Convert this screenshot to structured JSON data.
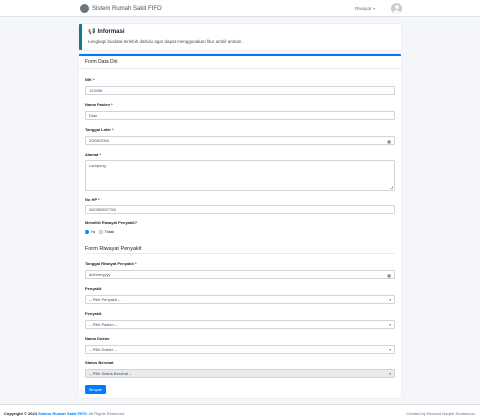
{
  "navbar": {
    "brand": "Sistem Rumah Sakit FIFO",
    "menu_label": "Riwayat",
    "menu_caret": "▾"
  },
  "info": {
    "icon": "megaphone-icon",
    "icon_glyph": "📢",
    "title": "Informasi",
    "text": "Lengkapi biodata terlebih dahulu agar dapat menggunakan fitur ambil antrian."
  },
  "form": {
    "header": "Form Data Diri",
    "nik": {
      "label": "NIK *",
      "value": "123456"
    },
    "nama": {
      "label": "Nama Pasien *",
      "value": "Dian"
    },
    "tgl_lahir": {
      "label": "Tanggal Lahir *",
      "value": "20/06/2004"
    },
    "alamat": {
      "label": "Alamat *",
      "value": "Lampung"
    },
    "hp": {
      "label": "No HP *",
      "value": "082289837758"
    },
    "riwayat_question": {
      "label": "Memiliki Riwayat Penyakit?",
      "options": [
        "Ya",
        "Tidak"
      ],
      "selected": "Ya"
    },
    "riwayat_section_title": "Form Riwayat Penyakit",
    "tgl_riwayat": {
      "label": "Tanggal Riwayat Penyakit *",
      "placeholder": "dd/mm/yyyy"
    },
    "penyakit1": {
      "label": "Penyakit",
      "value": "-- Pilih Penyakit --"
    },
    "penyakit2": {
      "label": "Penyakit",
      "value": "-- Pilih Pasien --"
    },
    "dokter": {
      "label": "Nama Dokter",
      "value": "-- Pilih Dokter --"
    },
    "status": {
      "label": "Status Berobat",
      "value": "-- Pilih Status Berobat --"
    },
    "submit_label": "Simpan"
  },
  "footer": {
    "copyright_prefix": "Copyright © 2024",
    "copyright_link": "Sistem Rumah Sakit FIFO.",
    "copyright_suffix": "All Rights Reserved.",
    "credit": "Created by Revizza Naqfizi Sudarsono."
  }
}
